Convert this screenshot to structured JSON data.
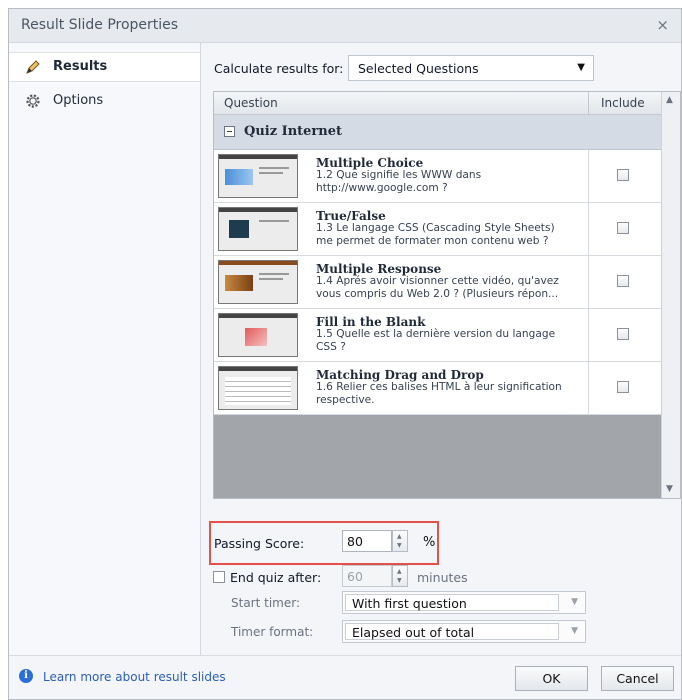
{
  "window": {
    "title": "Result Slide Properties",
    "close_glyph": "×"
  },
  "sidebar": {
    "items": [
      {
        "label": "Results",
        "icon": "pencil-icon",
        "selected": true
      },
      {
        "label": "Options",
        "icon": "gear-icon",
        "selected": false
      }
    ]
  },
  "calc": {
    "label": "Calculate results for:",
    "value": "Selected Questions"
  },
  "table": {
    "headers": {
      "question": "Question",
      "include": "Include"
    },
    "group": {
      "name": "Quiz Internet"
    },
    "rows": [
      {
        "type": "Multiple Choice",
        "text": "1.2 Que signifie les WWW dans\nhttp://www.google.com ?",
        "include": false
      },
      {
        "type": "True/False",
        "text": "1.3 Le langage CSS (Cascading Style Sheets)\nme permet de formater mon contenu web ?",
        "include": false
      },
      {
        "type": "Multiple Response",
        "text": "1.4 Aprés avoir visionner cette vidéo, qu'avez\nvous compris du Web 2.0 ? (Plusieurs répon...",
        "include": false
      },
      {
        "type": "Fill in the Blank",
        "text": "1.5 Quelle est la dernière version du langage\nCSS ?",
        "include": false
      },
      {
        "type": "Matching Drag and Drop",
        "text": "1.6 Relier ces balises HTML à leur signification\nrespective.",
        "include": false
      }
    ]
  },
  "passing": {
    "label": "Passing Score:",
    "value": "80",
    "unit": "%"
  },
  "end_quiz": {
    "label": "End quiz after:",
    "value": "60",
    "unit": "minutes",
    "checked": false
  },
  "timer": {
    "label": "Start timer:",
    "value": "With first question"
  },
  "format": {
    "label": "Timer format:",
    "value": "Elapsed out of total"
  },
  "footer": {
    "help_link": "Learn more about result slides",
    "ok": "OK",
    "cancel": "Cancel"
  },
  "colors": {
    "highlight": "#e2524a",
    "link": "#2b5fb4",
    "info_icon": "#2b6fd6"
  }
}
